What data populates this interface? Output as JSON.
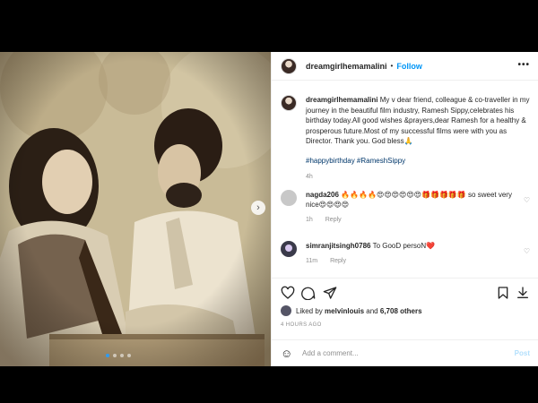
{
  "post": {
    "author": "dreamgirlhemamalini",
    "follow_sep": "•",
    "follow_label": "Follow",
    "more_icon": "more-horizontal-icon",
    "caption": "My v dear friend, colleague & co-traveller in my journey in the beautiful film industry, Ramesh Sippy,celebrates his birthday today.All good wishes &prayers,dear Ramesh for a healthy & prosperous future.Most of my successful films were with you as Director. Thank you. God bless🙏",
    "hashtags": "#happybirthday #RameshSippy",
    "caption_age": "4h"
  },
  "comments": [
    {
      "user": "nagda206",
      "text": "🔥🔥🔥🔥😍😍😍😍😍😍🎁🎁🎁🎁🎁 so sweet very nice😍😍😍😍",
      "age": "1h",
      "reply": "Reply"
    },
    {
      "user": "simranjitsingh0786",
      "text": "To GooD persoN❤️",
      "age": "11m",
      "reply": "Reply"
    }
  ],
  "actions": {
    "like_icon": "heart-icon",
    "comment_icon": "comment-icon",
    "share_icon": "send-icon",
    "save_icon": "bookmark-icon",
    "download_icon": "download-icon"
  },
  "likes": {
    "prefix": "Liked by",
    "user": "melvinlouis",
    "mid": "and",
    "count": "6,708 others"
  },
  "posted_ago": "4 HOURS AGO",
  "composer": {
    "placeholder": "Add a comment...",
    "post_label": "Post"
  },
  "carousel": {
    "count": 4,
    "active_index": 0
  },
  "colors": {
    "accent": "#0095f6",
    "post_disabled": "#b2dffc",
    "link": "#00376b"
  }
}
